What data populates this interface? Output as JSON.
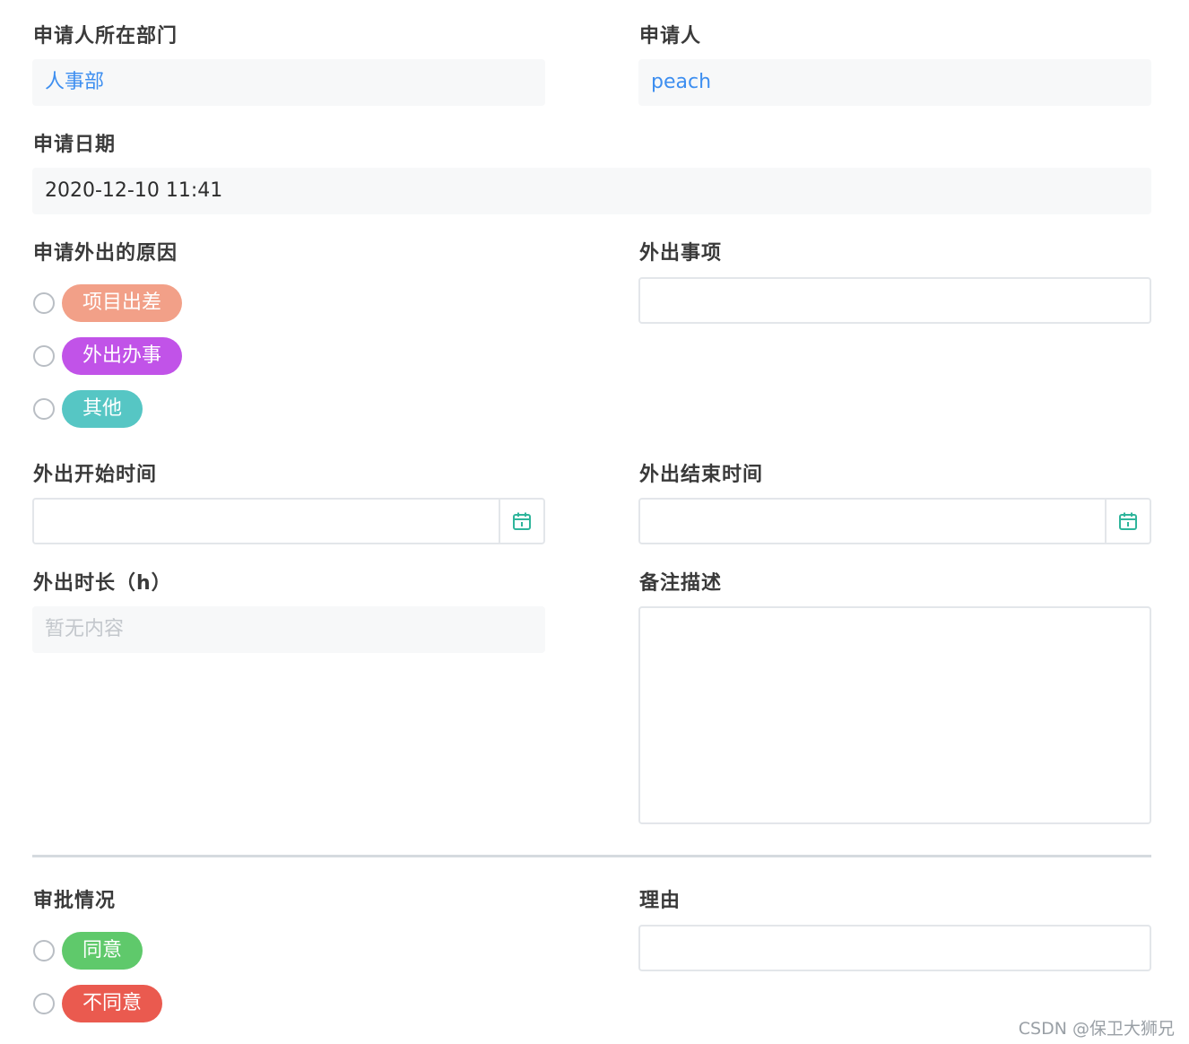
{
  "department": {
    "label": "申请人所在部门",
    "value": "人事部"
  },
  "applicant": {
    "label": "申请人",
    "value": "peach"
  },
  "apply_date": {
    "label": "申请日期",
    "value": "2020-12-10 11:41"
  },
  "reason": {
    "label": "申请外出的原因",
    "options": [
      {
        "label": "项目出差",
        "color": "#f2a088"
      },
      {
        "label": "外出办事",
        "color": "#c153e8"
      },
      {
        "label": "其他",
        "color": "#56c6c4"
      }
    ]
  },
  "matter": {
    "label": "外出事项",
    "value": ""
  },
  "start_time": {
    "label": "外出开始时间",
    "value": "",
    "icon": "calendar-icon"
  },
  "end_time": {
    "label": "外出结束时间",
    "value": "",
    "icon": "calendar-icon"
  },
  "duration": {
    "label": "外出时长（h）",
    "placeholder": "暂无内容"
  },
  "remarks": {
    "label": "备注描述",
    "value": ""
  },
  "approval": {
    "label": "审批情况",
    "options": [
      {
        "label": "同意",
        "color": "#5fc96b"
      },
      {
        "label": "不同意",
        "color": "#ea5a4f"
      }
    ]
  },
  "justification": {
    "label": "理由",
    "value": ""
  },
  "watermark": "CSDN @保卫大狮兄",
  "colors": {
    "accent_blue": "#3d8ef0",
    "calendar_icon": "#2fb59b",
    "readonly_bg": "#f7f8f9"
  }
}
